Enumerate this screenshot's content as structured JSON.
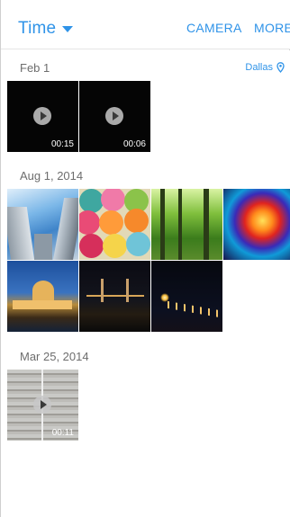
{
  "header": {
    "view_label": "Time",
    "camera_label": "CAMERA",
    "more_label": "MORE"
  },
  "sections": [
    {
      "date": "Feb 1",
      "location": "Dallas",
      "items": [
        {
          "kind": "video",
          "duration": "00:15"
        },
        {
          "kind": "video",
          "duration": "00:06"
        }
      ]
    },
    {
      "date": "Aug 1, 2014",
      "items": [
        {
          "kind": "photo",
          "subject": "skyscrapers"
        },
        {
          "kind": "photo",
          "subject": "yarn-balls"
        },
        {
          "kind": "photo",
          "subject": "forest"
        },
        {
          "kind": "photo",
          "subject": "stained-glass"
        },
        {
          "kind": "photo",
          "subject": "palace-night"
        },
        {
          "kind": "photo",
          "subject": "bridge-night"
        },
        {
          "kind": "photo",
          "subject": "city-lights-night"
        }
      ]
    },
    {
      "date": "Mar 25, 2014",
      "items": [
        {
          "kind": "video",
          "duration": "00:11"
        }
      ]
    }
  ],
  "colors": {
    "accent": "#2f93e8",
    "date_text": "#6d6d6d"
  },
  "icons": {
    "dropdown": "caret-down-icon",
    "location": "location-pin-icon",
    "play": "play-icon"
  }
}
